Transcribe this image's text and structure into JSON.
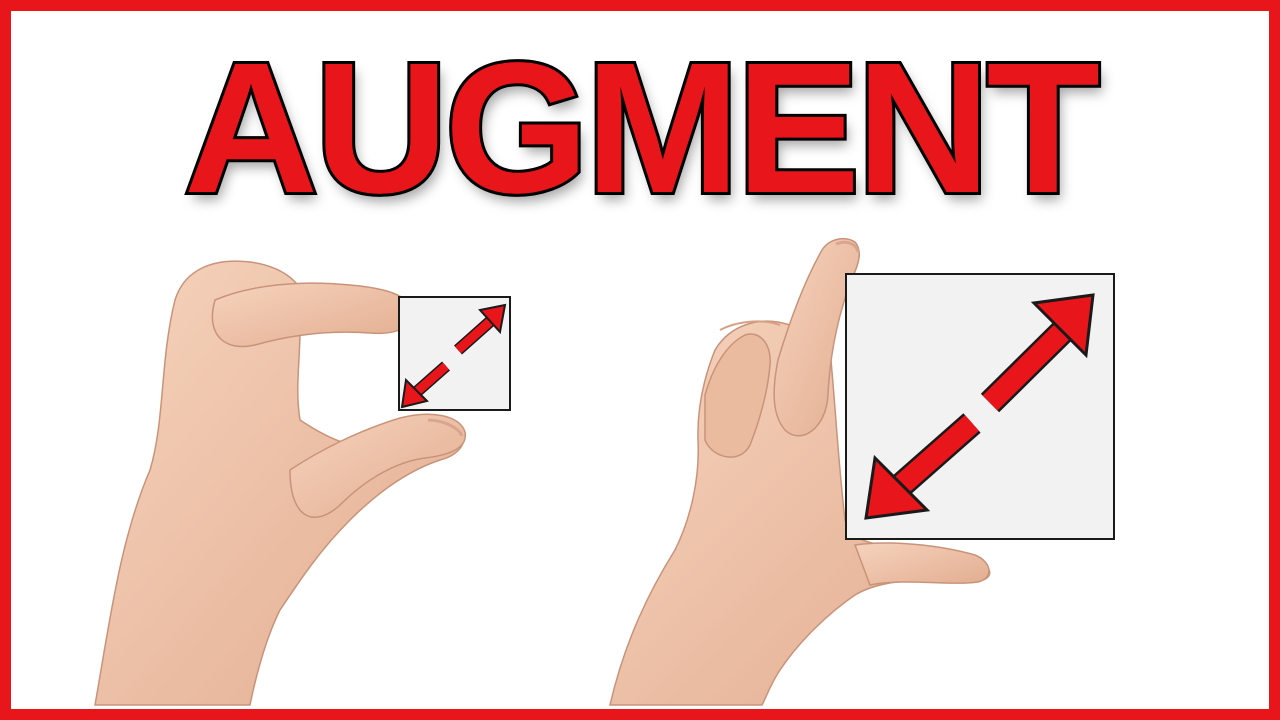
{
  "title": "AUGMENT",
  "colors": {
    "accent": "#e8151b",
    "outline": "#000000",
    "skin": "#efc4a8",
    "box_fill": "#f2f2f2"
  },
  "panels": [
    {
      "name": "small-square",
      "icon": "double-arrow-icon"
    },
    {
      "name": "large-square",
      "icon": "double-arrow-icon"
    }
  ]
}
